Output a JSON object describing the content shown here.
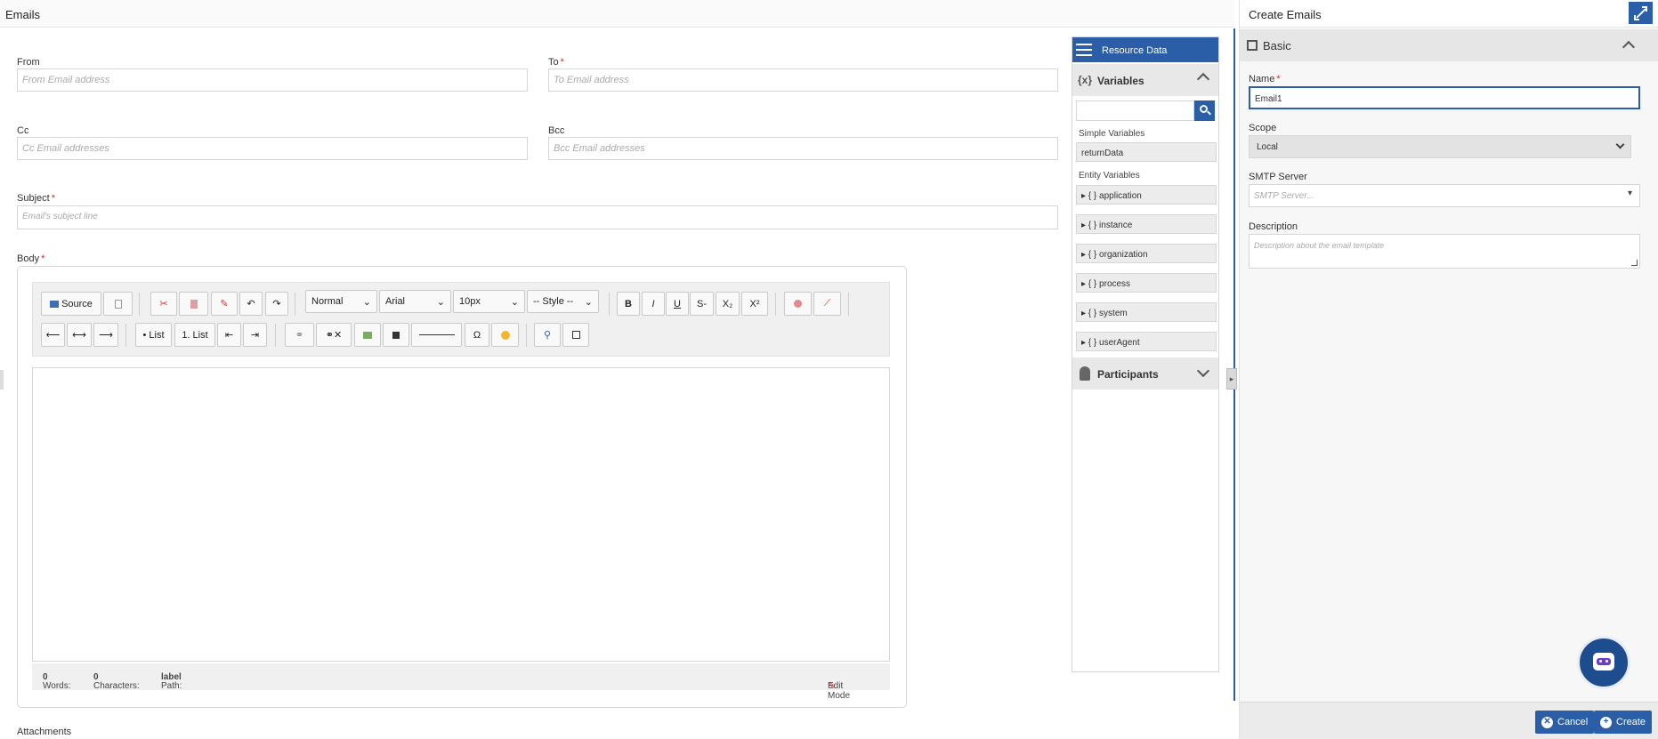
{
  "main": {
    "title": "Emails",
    "from": {
      "label": "From",
      "placeholder": "From Email address"
    },
    "to": {
      "label": "To",
      "placeholder": "To Email address"
    },
    "cc": {
      "label": "Cc",
      "placeholder": "Cc Email addresses"
    },
    "bcc": {
      "label": "Bcc",
      "placeholder": "Bcc Email addresses"
    },
    "subject": {
      "label": "Subject",
      "placeholder": "Email's subject line"
    },
    "body": {
      "label": "Body"
    },
    "attachments_label": "Attachments",
    "required_mark": "*"
  },
  "toolbar": {
    "source": "Source",
    "format": "Normal",
    "font": "Arial",
    "size": "10px",
    "style": "-- Style --",
    "bold": "B",
    "italic": "I",
    "underline": "U",
    "strike": "S-",
    "subscript": "X₂",
    "superscript": "X²",
    "bullet_list": "• List",
    "number_list": "1. List",
    "special_char": "Ω"
  },
  "editor_status": {
    "words_label": "Words:",
    "words": "0",
    "chars_label": "Characters:",
    "chars": "0",
    "path_label": "Path:",
    "path": "label",
    "edit_mode": "Edit Mode"
  },
  "resource": {
    "title": "Resource Data",
    "variables_title": "Variables",
    "simple_label": "Simple Variables",
    "simple_items": [
      "returnData"
    ],
    "entity_label": "Entity Variables",
    "entity_items": [
      "application",
      "instance",
      "organization",
      "process",
      "system",
      "userAgent"
    ],
    "participants_title": "Participants"
  },
  "panel": {
    "title": "Create Emails",
    "section": "Basic",
    "name_label": "Name",
    "name_value": "Email1",
    "scope_label": "Scope",
    "scope_value": "Local",
    "smtp_label": "SMTP Server",
    "smtp_placeholder": "SMTP Server...",
    "description_label": "Description",
    "description_placeholder": "Description about the email template",
    "cancel": "Cancel",
    "create": "Create"
  },
  "colors": {
    "accent": "#2a5fa8",
    "required": "#d9252c",
    "bot": "#1e4d8f"
  },
  "icons": [
    "expand-icon",
    "chevron-up-icon",
    "chevron-down-icon",
    "search-icon",
    "list-icon",
    "variables-icon",
    "participants-icon",
    "chatbot-icon"
  ]
}
